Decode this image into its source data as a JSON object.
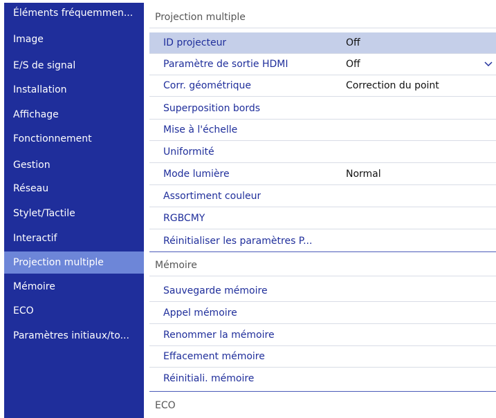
{
  "sidebar": {
    "items": [
      {
        "label": "Éléments fréquemmen..."
      },
      {
        "label": "Image"
      },
      {
        "label": "E/S de signal"
      },
      {
        "label": "Installation"
      },
      {
        "label": "Affichage"
      },
      {
        "label": "Fonctionnement"
      },
      {
        "label": "Gestion"
      },
      {
        "label": "Réseau"
      },
      {
        "label": "Stylet/Tactile"
      },
      {
        "label": "Interactif"
      },
      {
        "label": "Projection multiple"
      },
      {
        "label": "Mémoire"
      },
      {
        "label": "ECO"
      },
      {
        "label": "Paramètres initiaux/to..."
      }
    ],
    "selected": "Projection multiple"
  },
  "panel": {
    "section1": {
      "title": "Projection multiple"
    },
    "items1": [
      {
        "label": "ID projecteur",
        "value": "Off"
      },
      {
        "label": "Paramètre de sortie HDMI",
        "value": "Off"
      },
      {
        "label": "Corr. géométrique",
        "value": "Correction du point"
      },
      {
        "label": "Superposition bords",
        "value": ""
      },
      {
        "label": "Mise à l'échelle",
        "value": ""
      },
      {
        "label": "Uniformité",
        "value": ""
      },
      {
        "label": "Mode lumière",
        "value": "Normal"
      },
      {
        "label": "Assortiment couleur",
        "value": ""
      },
      {
        "label": "RGBCMY",
        "value": ""
      },
      {
        "label": "Réinitialiser les paramètres P...",
        "value": ""
      }
    ],
    "section2": {
      "title": "Mémoire"
    },
    "items2": [
      {
        "label": "Sauvegarde mémoire"
      },
      {
        "label": "Appel mémoire"
      },
      {
        "label": "Renommer la mémoire"
      },
      {
        "label": "Effacement mémoire"
      },
      {
        "label": "Réinitiali. mémoire"
      }
    ],
    "section3": {
      "title": "ECO"
    }
  },
  "icons": {
    "dropdown": "chevron-down-icon"
  },
  "colors": {
    "sidebar": "#1f2e9b",
    "selected": "#6d86d8",
    "highlight": "#c5cfe9"
  }
}
